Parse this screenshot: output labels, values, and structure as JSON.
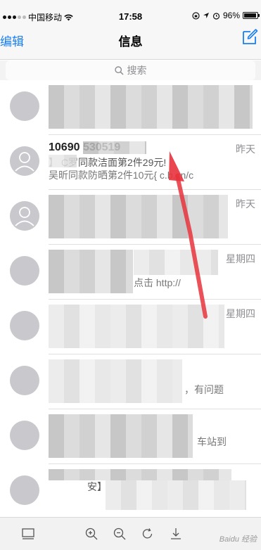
{
  "status": {
    "carrier": "中国移动",
    "time": "17:58",
    "battery": "96%"
  },
  "nav": {
    "edit_label": "编辑",
    "title": "信息"
  },
  "search": {
    "placeholder": "搜索"
  },
  "messages": [
    {
      "sender": "",
      "time": "",
      "preview": "",
      "preview2": ""
    },
    {
      "sender": "10690 530519",
      "time": "昨天",
      "preview": "】 C罗同款洁面第2件29元!",
      "preview2": "吴昕同款防晒第2件10元{ c.b.cn/c"
    },
    {
      "sender": "",
      "time": "昨天",
      "preview": "",
      "preview2": ""
    },
    {
      "sender": "",
      "time": "星期四",
      "preview": "",
      "preview2": "点击 http://"
    },
    {
      "sender": "",
      "time": "星期四",
      "preview": "",
      "preview2": ""
    },
    {
      "sender": "",
      "time": "",
      "preview": "",
      "preview2": "，有问题"
    },
    {
      "sender": "",
      "time": "",
      "preview": "",
      "preview2": "车站到"
    },
    {
      "sender": "",
      "time": "",
      "preview": "安】",
      "preview2": ""
    }
  ],
  "toolbar": {
    "watermark": "Baidu 经验"
  },
  "colors": {
    "accent": "#1a7ff0",
    "annotation_arrow": "#e8323c"
  }
}
